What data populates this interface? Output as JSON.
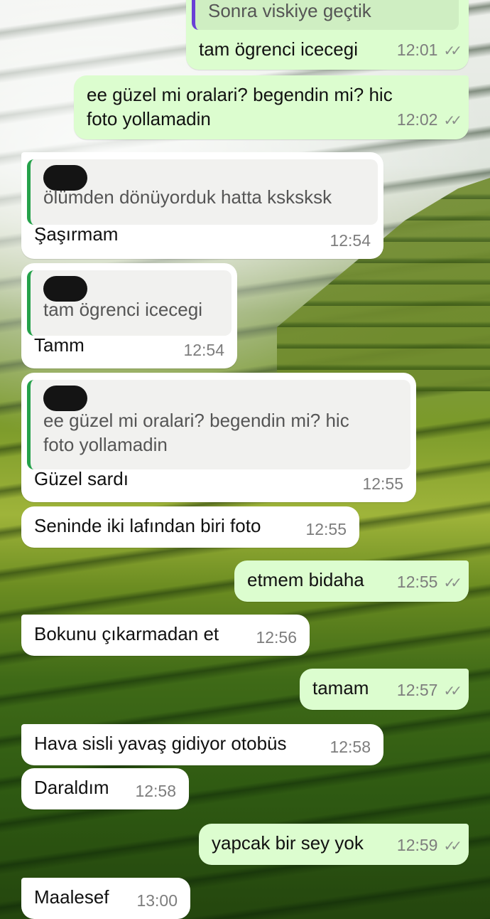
{
  "messages": [
    {
      "quote": "Sonra viskiye geçtik",
      "text": "tam ögrenci icecegi",
      "time": "12:01"
    },
    {
      "text": "ee güzel mi oralari? begendin mi? hic foto yollamadin",
      "time": "12:02"
    },
    {
      "quote": "ölümden dönüyorduk hatta ksksksk",
      "text": "Şaşırmam",
      "time": "12:54"
    },
    {
      "quote": "tam ögrenci icecegi",
      "text": "Tamm",
      "time": "12:54"
    },
    {
      "quote": "ee güzel mi oralari? begendin mi? hic foto yollamadin",
      "text": "Güzel sardı",
      "time": "12:55"
    },
    {
      "text": "Seninde iki lafından biri foto",
      "time": "12:55"
    },
    {
      "text": "etmem bidaha",
      "time": "12:55"
    },
    {
      "text": "Bokunu çıkarmadan et",
      "time": "12:56"
    },
    {
      "text": "tamam",
      "time": "12:57"
    },
    {
      "text": "Hava sisli yavaş gidiyor otobüs",
      "time": "12:58"
    },
    {
      "text": "Daraldım",
      "time": "12:58"
    },
    {
      "text": "yapcak bir sey yok",
      "time": "12:59"
    },
    {
      "text": "Maalesef",
      "time": "13:00"
    }
  ],
  "icons": {
    "read_receipt": "double-check-icon"
  },
  "colors": {
    "outgoing_bubble": "#dcfdcf",
    "incoming_bubble": "#ffffff",
    "quote_bar_incoming": "#25a14a",
    "quote_bar_outgoing": "#6a3fd6"
  }
}
